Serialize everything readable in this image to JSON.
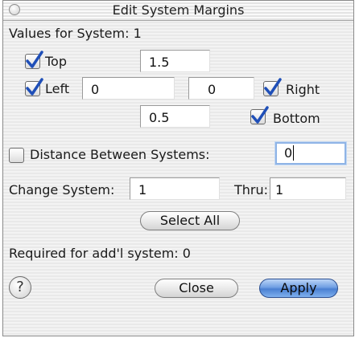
{
  "window": {
    "title": "Edit System Margins"
  },
  "header": {
    "values_label": "Values for System: 1"
  },
  "margins": {
    "top": {
      "label": "Top",
      "checked": true,
      "value": "1.5"
    },
    "left": {
      "label": "Left",
      "checked": true,
      "value": "0"
    },
    "right": {
      "label": "Right",
      "checked": true,
      "value": "0"
    },
    "bottom": {
      "label": "Bottom",
      "checked": true,
      "value": "0.5"
    }
  },
  "distance": {
    "label": "Distance Between Systems:",
    "checked": false,
    "value": "0"
  },
  "change": {
    "label": "Change System:",
    "value": "1",
    "thru_label": "Thru:",
    "thru_value": "1"
  },
  "select_all_label": "Select All",
  "required_text": "Required for add'l system: 0",
  "help_symbol": "?",
  "buttons": {
    "close": "Close",
    "apply": "Apply"
  },
  "colors": {
    "accent": "#4a80d2",
    "check": "#1f4fb8",
    "focus": "#8fb4e6"
  }
}
